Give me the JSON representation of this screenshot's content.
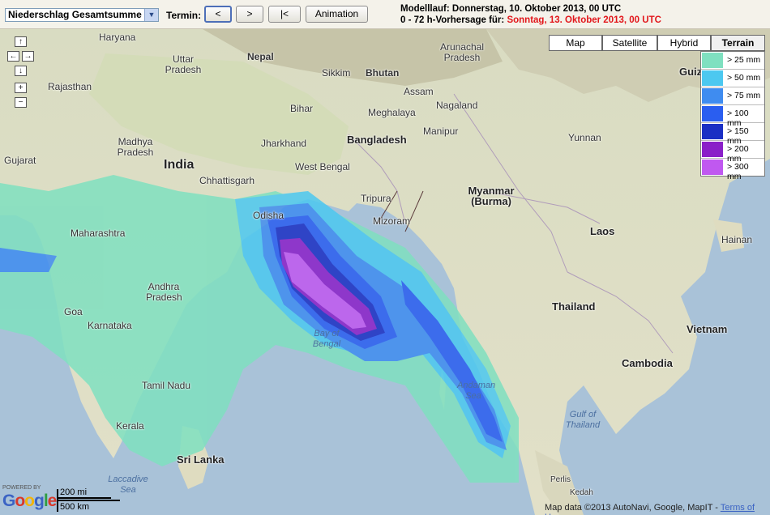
{
  "toolbar": {
    "parameter_select": "Niederschlag Gesamtsumme",
    "termin_label": "Termin:",
    "btn_prev": "<",
    "btn_next": ">",
    "btn_first": "|<",
    "btn_animation": "Animation",
    "model_run": "Modelllauf: Donnerstag, 10. Oktober 2013, 00 UTC",
    "forecast_prefix": "0 - 72 h-Vorhersage für:",
    "forecast_date": "Sonntag, 13. Oktober 2013, 00 UTC",
    "forecast_date_color": "#e2161b"
  },
  "map_types": [
    "Map",
    "Satellite",
    "Hybrid",
    "Terrain"
  ],
  "map_type_selected": "Terrain",
  "nav": {
    "up": "↑",
    "left": "←",
    "right": "→",
    "down": "↓",
    "zoom_in": "+",
    "zoom_out": "−"
  },
  "legend": [
    {
      "label": "> 25 mm",
      "color": "#7fe0c0"
    },
    {
      "label": "> 50 mm",
      "color": "#4cc8f0"
    },
    {
      "label": "> 75 mm",
      "color": "#3f8cf0"
    },
    {
      "label": "> 100 mm",
      "color": "#2a5ef0"
    },
    {
      "label": "> 150 mm",
      "color": "#1a2fc4"
    },
    {
      "label": "> 200 mm",
      "color": "#8a1fc8"
    },
    {
      "label": "> 300 mm",
      "color": "#c058f0"
    }
  ],
  "labels": {
    "haryana": "Haryana",
    "uttar_pradesh": "Uttar Pradesh",
    "nepal": "Nepal",
    "arunachal": "Arunachal Pradesh",
    "sikkim": "Sikkim",
    "bhutan": "Bhutan",
    "rajasthan": "Rajasthan",
    "bihar": "Bihar",
    "assam": "Assam",
    "meghalaya": "Meghalaya",
    "nagaland": "Nagaland",
    "jharkhand": "Jharkhand",
    "madhya_pradesh": "Madhya Pradesh",
    "bangladesh": "Bangladesh",
    "manipur": "Manipur",
    "yunnan": "Yunnan",
    "gujarat": "Gujarat",
    "india": "India",
    "chhattisgarh": "Chhattisgarh",
    "west_bengal": "West Bengal",
    "myanmar": "Myanmar (Burma)",
    "tripura": "Tripura",
    "odisha": "Odisha",
    "mizoram": "Mizoram",
    "maharashtra": "Maharashtra",
    "laos": "Laos",
    "hainan": "Hainan",
    "andhra": "Andhra Pradesh",
    "thailand": "Thailand",
    "goa": "Goa",
    "karnataka": "Karnataka",
    "bay_of_bengal": "Bay of Bengal",
    "vietnam": "Vietnam",
    "cambodia": "Cambodia",
    "tamil_nadu": "Tamil Nadu",
    "andaman_sea": "Andaman Sea",
    "gulf_of_thailand": "Gulf of Thailand",
    "kerala": "Kerala",
    "sri_lanka": "Sri Lanka",
    "laccadive_sea": "Laccadive Sea",
    "perlis": "Perlis",
    "kedah": "Kedah",
    "guiz": "Guiz"
  },
  "scale": {
    "miles": "200 mi",
    "km": "500 km"
  },
  "powered_by": "POWERED BY",
  "google": "Google",
  "copyright": "Map data ©2013 AutoNavi, Google, MapIT -",
  "terms": "Terms of Use"
}
